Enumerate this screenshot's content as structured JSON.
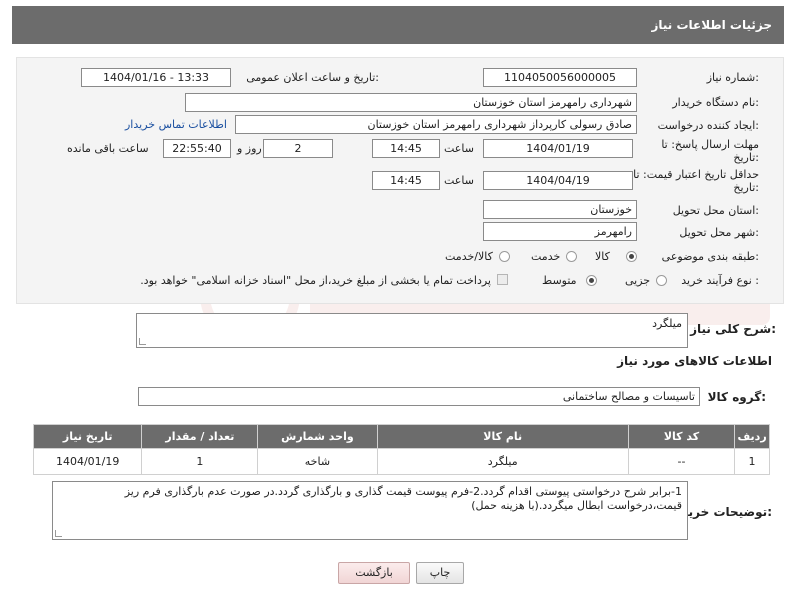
{
  "header": {
    "title": "جزئیات اطلاعات نیاز"
  },
  "form": {
    "need_number_label": "شماره نیاز:",
    "need_number": "1104050056000005",
    "announce_label": "تاریخ و ساعت اعلان عمومی:",
    "announce_value": "1404/01/16 - 13:33",
    "buyer_org_label": "نام دستگاه خریدار:",
    "buyer_org": "شهرداری رامهرمز استان خوزستان",
    "creator_label": "ایجاد کننده درخواست:",
    "creator": "صادق رسولی کارپرداز شهرداری رامهرمز استان خوزستان",
    "contact_link": "اطلاعات تماس خریدار",
    "reply_deadline_label": "مهلت ارسال پاسخ: تا تاریخ:",
    "reply_date": "1404/01/19",
    "time_label": "ساعت",
    "reply_time": "14:45",
    "days_value": "2",
    "days_label": "روز و",
    "remaining_time": "22:55:40",
    "remaining_label": "ساعت باقی مانده",
    "price_validity_label": "حداقل تاریخ اعتبار قیمت: تا تاریخ:",
    "price_date": "1404/04/19",
    "price_time": "14:45",
    "province_label": "استان محل تحویل:",
    "province": "خوزستان",
    "city_label": "شهر محل تحویل:",
    "city": "رامهرمز",
    "category_label": "طبقه بندی موضوعی:",
    "category_options": [
      "کالا",
      "خدمت",
      "کالا/خدمت"
    ],
    "category_selected": "کالا",
    "process_label": "نوع فرآیند خرید :",
    "process_options": [
      "جزیی",
      "متوسط"
    ],
    "process_selected": "جزیی",
    "payment_note": "پرداخت تمام یا بخشی از مبلغ خرید،از محل \"اسناد خزانه اسلامی\" خواهد بود."
  },
  "description": {
    "label": "شرح کلی نیاز:",
    "value": "میلگرد"
  },
  "goods_section": {
    "title": "اطلاعات کالاهای مورد نیاز",
    "group_label": "گروه کالا:",
    "group_value": "تاسیسات و مصالح ساختمانی"
  },
  "table": {
    "headers": [
      "ردیف",
      "کد کالا",
      "نام کالا",
      "واحد شمارش",
      "تعداد / مقدار",
      "تاریخ نیاز"
    ],
    "rows": [
      [
        "1",
        "--",
        "میلگرد",
        "شاخه",
        "1",
        "1404/01/19"
      ]
    ]
  },
  "buyer_notes": {
    "label": "توضیحات خریدار:",
    "value": "1-برابر شرح درخواستی پیوستی اقدام گردد.2-فرم پیوست قیمت گذاری و بارگذاری گردد.در صورت عدم بارگذاری فرم ریز قیمت،درخواست ابطال میگردد.(با هزینه حمل)"
  },
  "buttons": {
    "print": "چاپ",
    "back": "بازگشت"
  },
  "colors": {
    "header_bg": "#6c6c6c",
    "link": "#1a4fa0",
    "panel_bg": "#f4f4f4"
  }
}
